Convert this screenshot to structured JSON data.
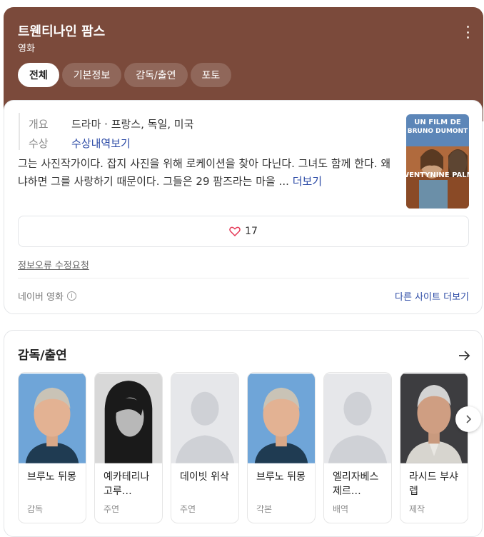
{
  "header": {
    "title": "트웬티나인 팜스",
    "subtitle": "영화",
    "more_icon": "more-vertical-icon",
    "background_color": "#7b4a3b"
  },
  "tabs": [
    {
      "label": "전체",
      "active": true
    },
    {
      "label": "기본정보",
      "active": false
    },
    {
      "label": "감독/출연",
      "active": false
    },
    {
      "label": "포토",
      "active": false
    }
  ],
  "info": {
    "overview_label": "개요",
    "overview_value": "드라마 · 프랑스, 독일, 미국",
    "award_label": "수상",
    "award_link": "수상내역보기"
  },
  "synopsis": {
    "text": "그는 사진작가이다. 잡지 사진을 위해 로케이션을 찾아 다닌다. 그녀도 함께 한다. 왜냐하면 그를 사랑하기 때문이다. 그들은 29 팜즈라는 마을 ...",
    "more_label": "더보기"
  },
  "poster": {
    "line1": "UN FILM DE",
    "line2": "BRUNO DUMONT",
    "title": "TWENTYNINE PALMS"
  },
  "like": {
    "icon": "heart-icon",
    "count": "17"
  },
  "report_label": "정보오류 수정요청",
  "source_label": "네이버 영화",
  "other_sites_label": "다른 사이트 더보기",
  "cast_section": {
    "title": "감독/출연",
    "people": [
      {
        "name": "브루노 뒤몽",
        "role": "감독",
        "photo": "man"
      },
      {
        "name": "예카테리나 고루…",
        "role": "주연",
        "photo": "woman"
      },
      {
        "name": "데이빗 위삭",
        "role": "주연",
        "photo": "placeholder"
      },
      {
        "name": "브루노 뒤몽",
        "role": "각본",
        "photo": "man"
      },
      {
        "name": "엘리자베스 제르…",
        "role": "배역",
        "photo": "placeholder"
      },
      {
        "name": "라시드 부샤렙",
        "role": "제작",
        "photo": "grayman"
      }
    ]
  }
}
